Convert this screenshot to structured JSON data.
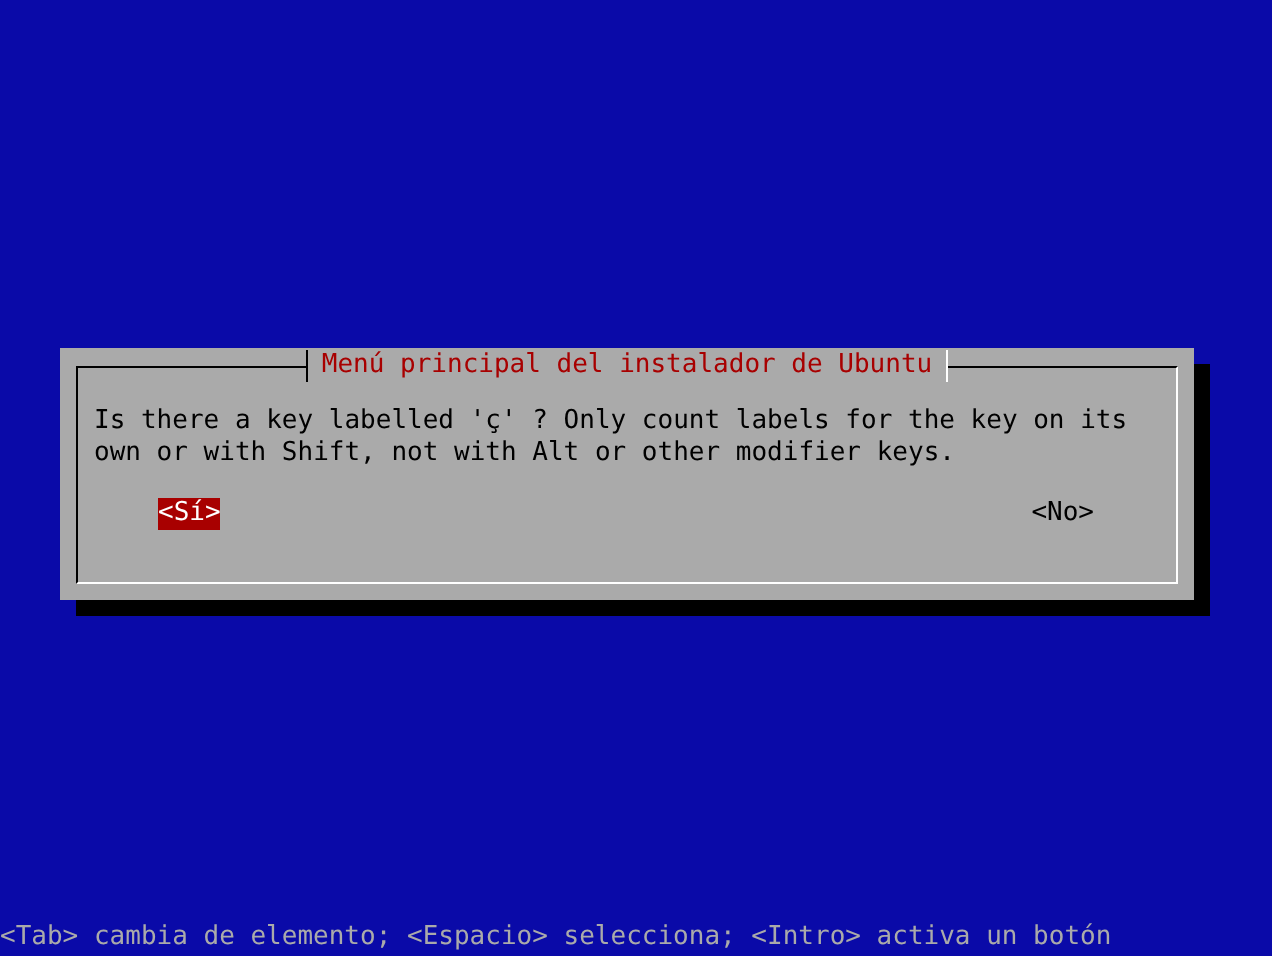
{
  "dialog": {
    "title": "Menú principal del instalador de Ubuntu",
    "message": "Is there a key labelled 'ç' ? Only count labels for the key on its own or with Shift, not with Alt or other modifier keys.",
    "buttons": [
      {
        "label": "<Sí>",
        "selected": true
      },
      {
        "label": "<No>",
        "selected": false
      }
    ]
  },
  "status_bar": "<Tab> cambia de elemento; <Espacio> selecciona; <Intro> activa un botón"
}
